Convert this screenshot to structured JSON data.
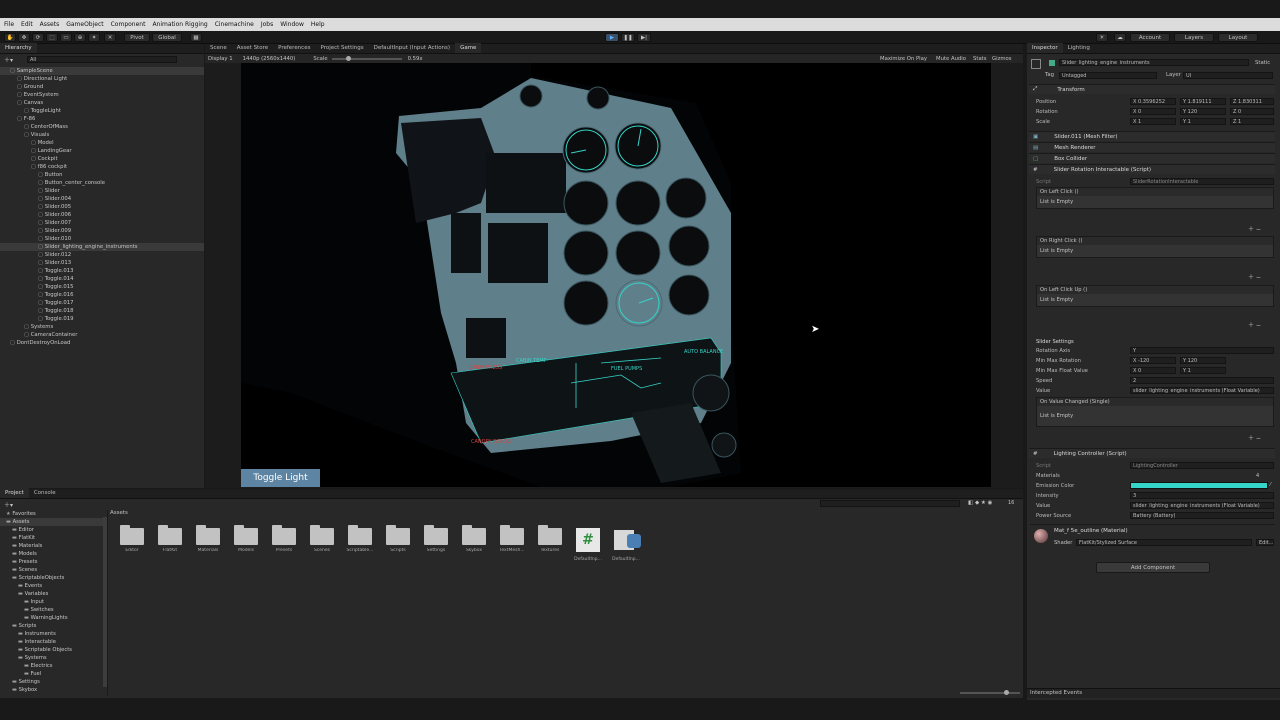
{
  "menu": [
    "File",
    "Edit",
    "Assets",
    "GameObject",
    "Component",
    "Animation Rigging",
    "Cinemachine",
    "Jobs",
    "Window",
    "Help"
  ],
  "toolbar": {
    "pivot": "Pivot",
    "global": "Global",
    "account": "Account",
    "layers": "Layers",
    "layout": "Layout"
  },
  "hierarchy": {
    "tab": "Hierarchy",
    "search_placeholder": "All",
    "items": [
      "SampleScene",
      "Directional Light",
      "Ground",
      "EventSystem",
      "Canvas",
      "ToggleLight",
      "F-86",
      "CenterOfMass",
      "Visuals",
      "Model",
      "LandingGear",
      "Cockpit",
      "f86 cockpit",
      "Button",
      "Button_center_console",
      "Slider",
      "Slider.004",
      "Slider.005",
      "Slider.006",
      "Slider.007",
      "Slider.009",
      "Slider.010",
      "Slider_lighting_engine_instruments",
      "Slider.012",
      "Slider.013",
      "Toggle.013",
      "Toggle.014",
      "Toggle.015",
      "Toggle.016",
      "Toggle.017",
      "Toggle.018",
      "Toggle.019",
      "Systems",
      "CameraContainer",
      "DontDestroyOnLoad"
    ]
  },
  "center_tabs": [
    "Scene",
    "Asset Store",
    "Preferences",
    "Project Settings",
    "DefaultInput (Input Actions)",
    "Game"
  ],
  "game_bar": {
    "display": "Display 1",
    "resolution": "1440p (2560x1440)",
    "scale_label": "Scale",
    "scale_value": "0.59x",
    "maximize": "Maximize On Play",
    "mute": "Mute Audio",
    "stats": "Stats",
    "gizmos": "Gizmos"
  },
  "game_view": {
    "toggle_button": "Toggle Light",
    "panel_labels": {
      "cabin_press": "CABIN PRESS",
      "cabin_temp": "CABIN TEMP",
      "fuel_pumps": "FUEL PUMPS",
      "auto_balance": "AUTO BALANCE",
      "canopy": "CANOPY DEFOG"
    }
  },
  "inspector": {
    "tabs": [
      "Inspector",
      "Lighting"
    ],
    "object_name": "Slider_lighting_engine_instruments",
    "static": "Static",
    "tag_label": "Tag",
    "tag": "Untagged",
    "layer_label": "Layer",
    "layer": "UI",
    "transform": {
      "title": "Transform",
      "position": {
        "x": "0.3596252",
        "y": "1.819111",
        "z": "1.830311"
      },
      "rotation": {
        "x": "0",
        "y": "120",
        "z": "0"
      },
      "scale": {
        "x": "1",
        "y": "1",
        "z": "1"
      },
      "labels": [
        "Position",
        "Rotation",
        "Scale"
      ]
    },
    "components": [
      "Slider.011 (Mesh Filter)",
      "Mesh Renderer",
      "Box Collider",
      "Slider Rotation Interactable (Script)"
    ],
    "script_label": "Script",
    "script_value": "SliderRotationInteractable",
    "events": [
      {
        "title": "On Left Click ()",
        "body": "List is Empty"
      },
      {
        "title": "On Right Click ()",
        "body": "List is Empty"
      },
      {
        "title": "On Left Click Up ()",
        "body": "List is Empty"
      }
    ],
    "slider_settings": {
      "header": "Slider Settings",
      "rotation_axis_label": "Rotation Axis",
      "rotation_axis": "Y",
      "min_max_rotation_label": "Min Max Rotation",
      "min_rot_x": "-120",
      "min_rot_y": "120",
      "min_max_float_label": "Min Max Float Value",
      "min_float_x": "0",
      "min_float_y": "1",
      "speed_label": "Speed",
      "speed": "2",
      "value_label": "Value",
      "value": "slider_lighting_engine_instruments (Float Variable)"
    },
    "value_changed": {
      "title": "On Value Changed (Single)",
      "body": "List is Empty"
    },
    "lighting": {
      "title": "Lighting Controller (Script)",
      "script_label": "Script",
      "script": "LightingController",
      "materials_label": "Materials",
      "materials_count": "4",
      "emission_label": "Emission Color",
      "emission_color": "#36d3c8",
      "intensity_label": "Intensity",
      "intensity": "3",
      "value_label": "Value",
      "value": "slider_lighting_engine_instruments (Float Variable)",
      "power_label": "Power Source",
      "power": "Battery (Battery)"
    },
    "material": {
      "name": "Mat_f 5e_outline (Material)",
      "shader_label": "Shader",
      "shader": "FlatKit/Stylized Surface",
      "edit": "Edit..."
    },
    "add_component": "Add Component",
    "intercepted": "Intercepted Events"
  },
  "project": {
    "tabs": [
      "Project",
      "Console"
    ],
    "breadcrumb": "Assets",
    "tree": [
      "Favorites",
      "Assets",
      "Editor",
      "FlatKit",
      "Materials",
      "Models",
      "Presets",
      "Scenes",
      "ScriptableObjects",
      "Events",
      "Variables",
      "Input",
      "Switches",
      "WarningLights",
      "Scripts",
      "Instruments",
      "Interactable",
      "Scriptable Objects",
      "Systems",
      "Electrics",
      "Fuel",
      "Settings",
      "Skybox"
    ],
    "folders": [
      "Editor",
      "FlatKit",
      "Materials",
      "Models",
      "Presets",
      "Scenes",
      "Scriptable...",
      "Scripts",
      "Settings",
      "Skybox",
      "TextMesh...",
      "Textures"
    ],
    "files": [
      "DefaultInp...",
      "DefaultInp..."
    ],
    "count": "16"
  }
}
